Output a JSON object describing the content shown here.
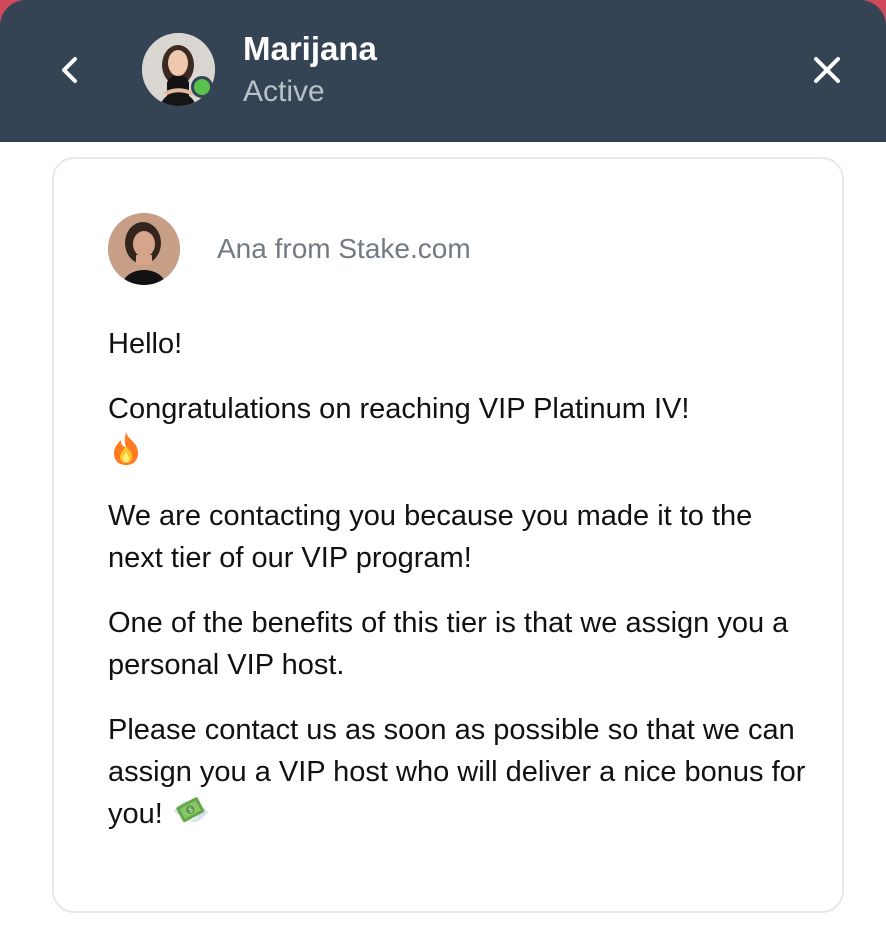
{
  "header": {
    "contact_name": "Marijana",
    "status": "Active",
    "back_icon": "chevron-left-icon",
    "close_icon": "close-icon",
    "background_color": "#354454",
    "online_indicator_color": "#58c24c"
  },
  "message": {
    "sender_name": "Ana from Stake.com",
    "paragraphs": [
      {
        "text": "Hello!"
      },
      {
        "text": "Congratulations on reaching VIP Platinum IV!",
        "emoji": "fire-emoji-icon"
      },
      {
        "text": "We are contacting you because you made it to the next tier of our VIP program!"
      },
      {
        "text": "One of the benefits of this tier is that we assign you a personal VIP host."
      },
      {
        "text": "Please contact us as soon as possible so that we can assign you a VIP host who will deliver a nice bonus for you!",
        "emoji": "money-with-wings-emoji-icon"
      }
    ]
  }
}
